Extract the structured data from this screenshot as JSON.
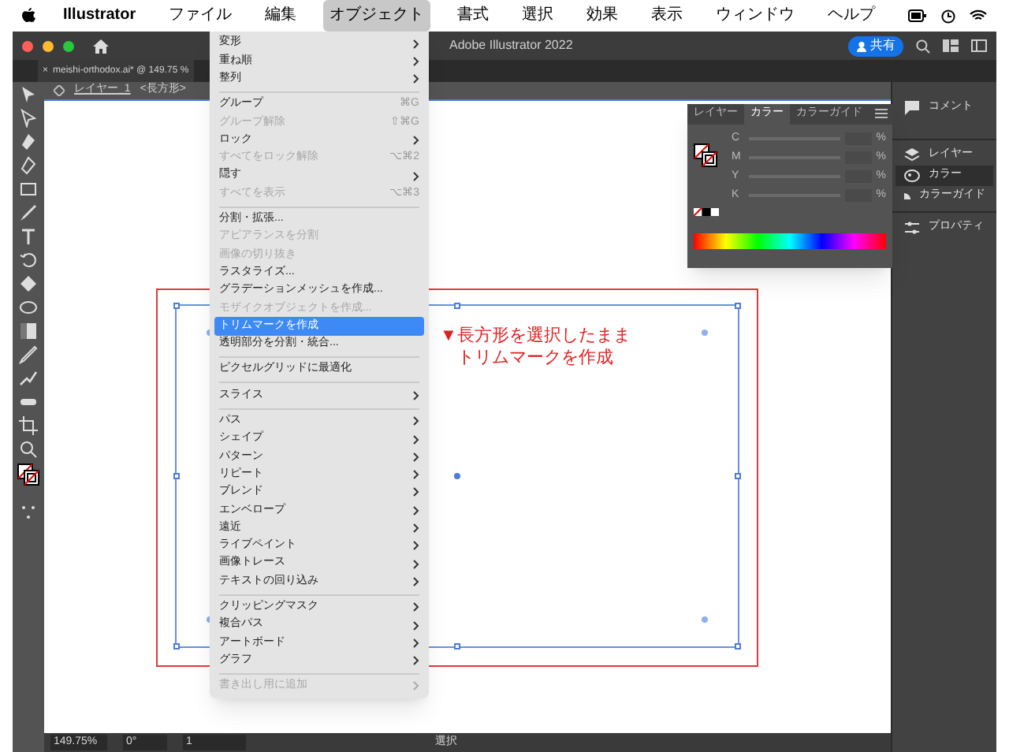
{
  "menu_bar": {
    "app_menus": [
      {
        "label": "Illustrator",
        "selected": false
      },
      {
        "label": "ファイル",
        "selected": false
      },
      {
        "label": "編集",
        "selected": false
      },
      {
        "label": "オブジェクト",
        "selected": true
      },
      {
        "label": "書式",
        "selected": false
      },
      {
        "label": "選択",
        "selected": false
      },
      {
        "label": "効果",
        "selected": false
      },
      {
        "label": "表示",
        "selected": false
      },
      {
        "label": "ウィンドウ",
        "selected": false
      },
      {
        "label": "ヘルプ",
        "selected": false
      }
    ]
  },
  "window": {
    "title": "Adobe Illustrator 2022",
    "share_button": "共有"
  },
  "document_tab": {
    "close": "×",
    "label": "meishi-orthodox.ai* @ 149.75 %"
  },
  "breadcrumb": {
    "layer": "レイヤー_1",
    "object": "<長方形>"
  },
  "object_menu": [
    [
      {
        "label": "変形",
        "submenu": true,
        "disabled": false,
        "selected": false
      },
      {
        "label": "重ね順",
        "submenu": true,
        "disabled": false,
        "selected": false
      },
      {
        "label": "整列",
        "submenu": true,
        "disabled": false,
        "selected": false
      }
    ],
    [
      {
        "label": "グループ",
        "shortcut": "⌘G",
        "submenu": false,
        "disabled": false,
        "selected": false
      },
      {
        "label": "グループ解除",
        "shortcut": "⇧⌘G",
        "submenu": false,
        "disabled": true,
        "selected": false
      },
      {
        "label": "ロック",
        "submenu": true,
        "disabled": false,
        "selected": false
      },
      {
        "label": "すべてをロック解除",
        "shortcut": "⌥⌘2",
        "submenu": false,
        "disabled": true,
        "selected": false
      },
      {
        "label": "隠す",
        "submenu": true,
        "disabled": false,
        "selected": false
      },
      {
        "label": "すべてを表示",
        "shortcut": "⌥⌘3",
        "submenu": false,
        "disabled": true,
        "selected": false
      }
    ],
    [
      {
        "label": "分割・拡張...",
        "submenu": false,
        "disabled": false,
        "selected": false
      },
      {
        "label": "アピアランスを分割",
        "submenu": false,
        "disabled": true,
        "selected": false
      },
      {
        "label": "画像の切り抜き",
        "submenu": false,
        "disabled": true,
        "selected": false
      },
      {
        "label": "ラスタライズ...",
        "submenu": false,
        "disabled": false,
        "selected": false
      },
      {
        "label": "グラデーションメッシュを作成...",
        "submenu": false,
        "disabled": false,
        "selected": false
      },
      {
        "label": "モザイクオブジェクトを作成...",
        "submenu": false,
        "disabled": true,
        "selected": false
      },
      {
        "label": "トリムマークを作成",
        "submenu": false,
        "disabled": false,
        "selected": true
      },
      {
        "label": "透明部分を分割・統合...",
        "submenu": false,
        "disabled": false,
        "selected": false
      }
    ],
    [
      {
        "label": "ピクセルグリッドに最適化",
        "submenu": false,
        "disabled": false,
        "selected": false
      }
    ],
    [
      {
        "label": "スライス",
        "submenu": true,
        "disabled": false,
        "selected": false
      }
    ],
    [
      {
        "label": "パス",
        "submenu": true,
        "disabled": false,
        "selected": false
      },
      {
        "label": "シェイプ",
        "submenu": true,
        "disabled": false,
        "selected": false
      },
      {
        "label": "パターン",
        "submenu": true,
        "disabled": false,
        "selected": false
      },
      {
        "label": "リピート",
        "submenu": true,
        "disabled": false,
        "selected": false
      },
      {
        "label": "ブレンド",
        "submenu": true,
        "disabled": false,
        "selected": false
      },
      {
        "label": "エンベロープ",
        "submenu": true,
        "disabled": false,
        "selected": false
      },
      {
        "label": "遠近",
        "submenu": true,
        "disabled": false,
        "selected": false
      },
      {
        "label": "ライブペイント",
        "submenu": true,
        "disabled": false,
        "selected": false
      },
      {
        "label": "画像トレース",
        "submenu": true,
        "disabled": false,
        "selected": false
      },
      {
        "label": "テキストの回り込み",
        "submenu": true,
        "disabled": false,
        "selected": false
      }
    ],
    [
      {
        "label": "クリッピングマスク",
        "submenu": true,
        "disabled": false,
        "selected": false
      },
      {
        "label": "複合パス",
        "submenu": true,
        "disabled": false,
        "selected": false
      },
      {
        "label": "アートボード",
        "submenu": true,
        "disabled": false,
        "selected": false
      },
      {
        "label": "グラフ",
        "submenu": true,
        "disabled": false,
        "selected": false
      }
    ],
    [
      {
        "label": "書き出し用に追加",
        "submenu": true,
        "disabled": true,
        "selected": false
      }
    ]
  ],
  "annotation": [
    "▼長方形を選択したまま",
    "トリムマークを作成"
  ],
  "color_panel": {
    "tabs": [
      {
        "label": "レイヤー",
        "selected": false
      },
      {
        "label": "カラー",
        "selected": true
      },
      {
        "label": "カラーガイド",
        "selected": false
      }
    ],
    "channels": [
      {
        "name": "C",
        "level": 0,
        "unit": "%"
      },
      {
        "name": "M",
        "level": 0,
        "unit": "%"
      },
      {
        "name": "Y",
        "level": 0,
        "unit": "%"
      },
      {
        "name": "K",
        "level": 0,
        "unit": "%"
      }
    ]
  },
  "right_panel": [
    {
      "label": "コメント",
      "selected": false
    },
    {
      "label": "レイヤー",
      "selected": false
    },
    {
      "label": "カラー",
      "selected": true
    },
    {
      "label": "カラーガイド",
      "selected": false
    },
    {
      "label": "プロパティ",
      "selected": false
    }
  ],
  "status_bar": {
    "zoom": "149.75%",
    "rotation": "0°",
    "artboard": "1",
    "tool": "選択"
  }
}
